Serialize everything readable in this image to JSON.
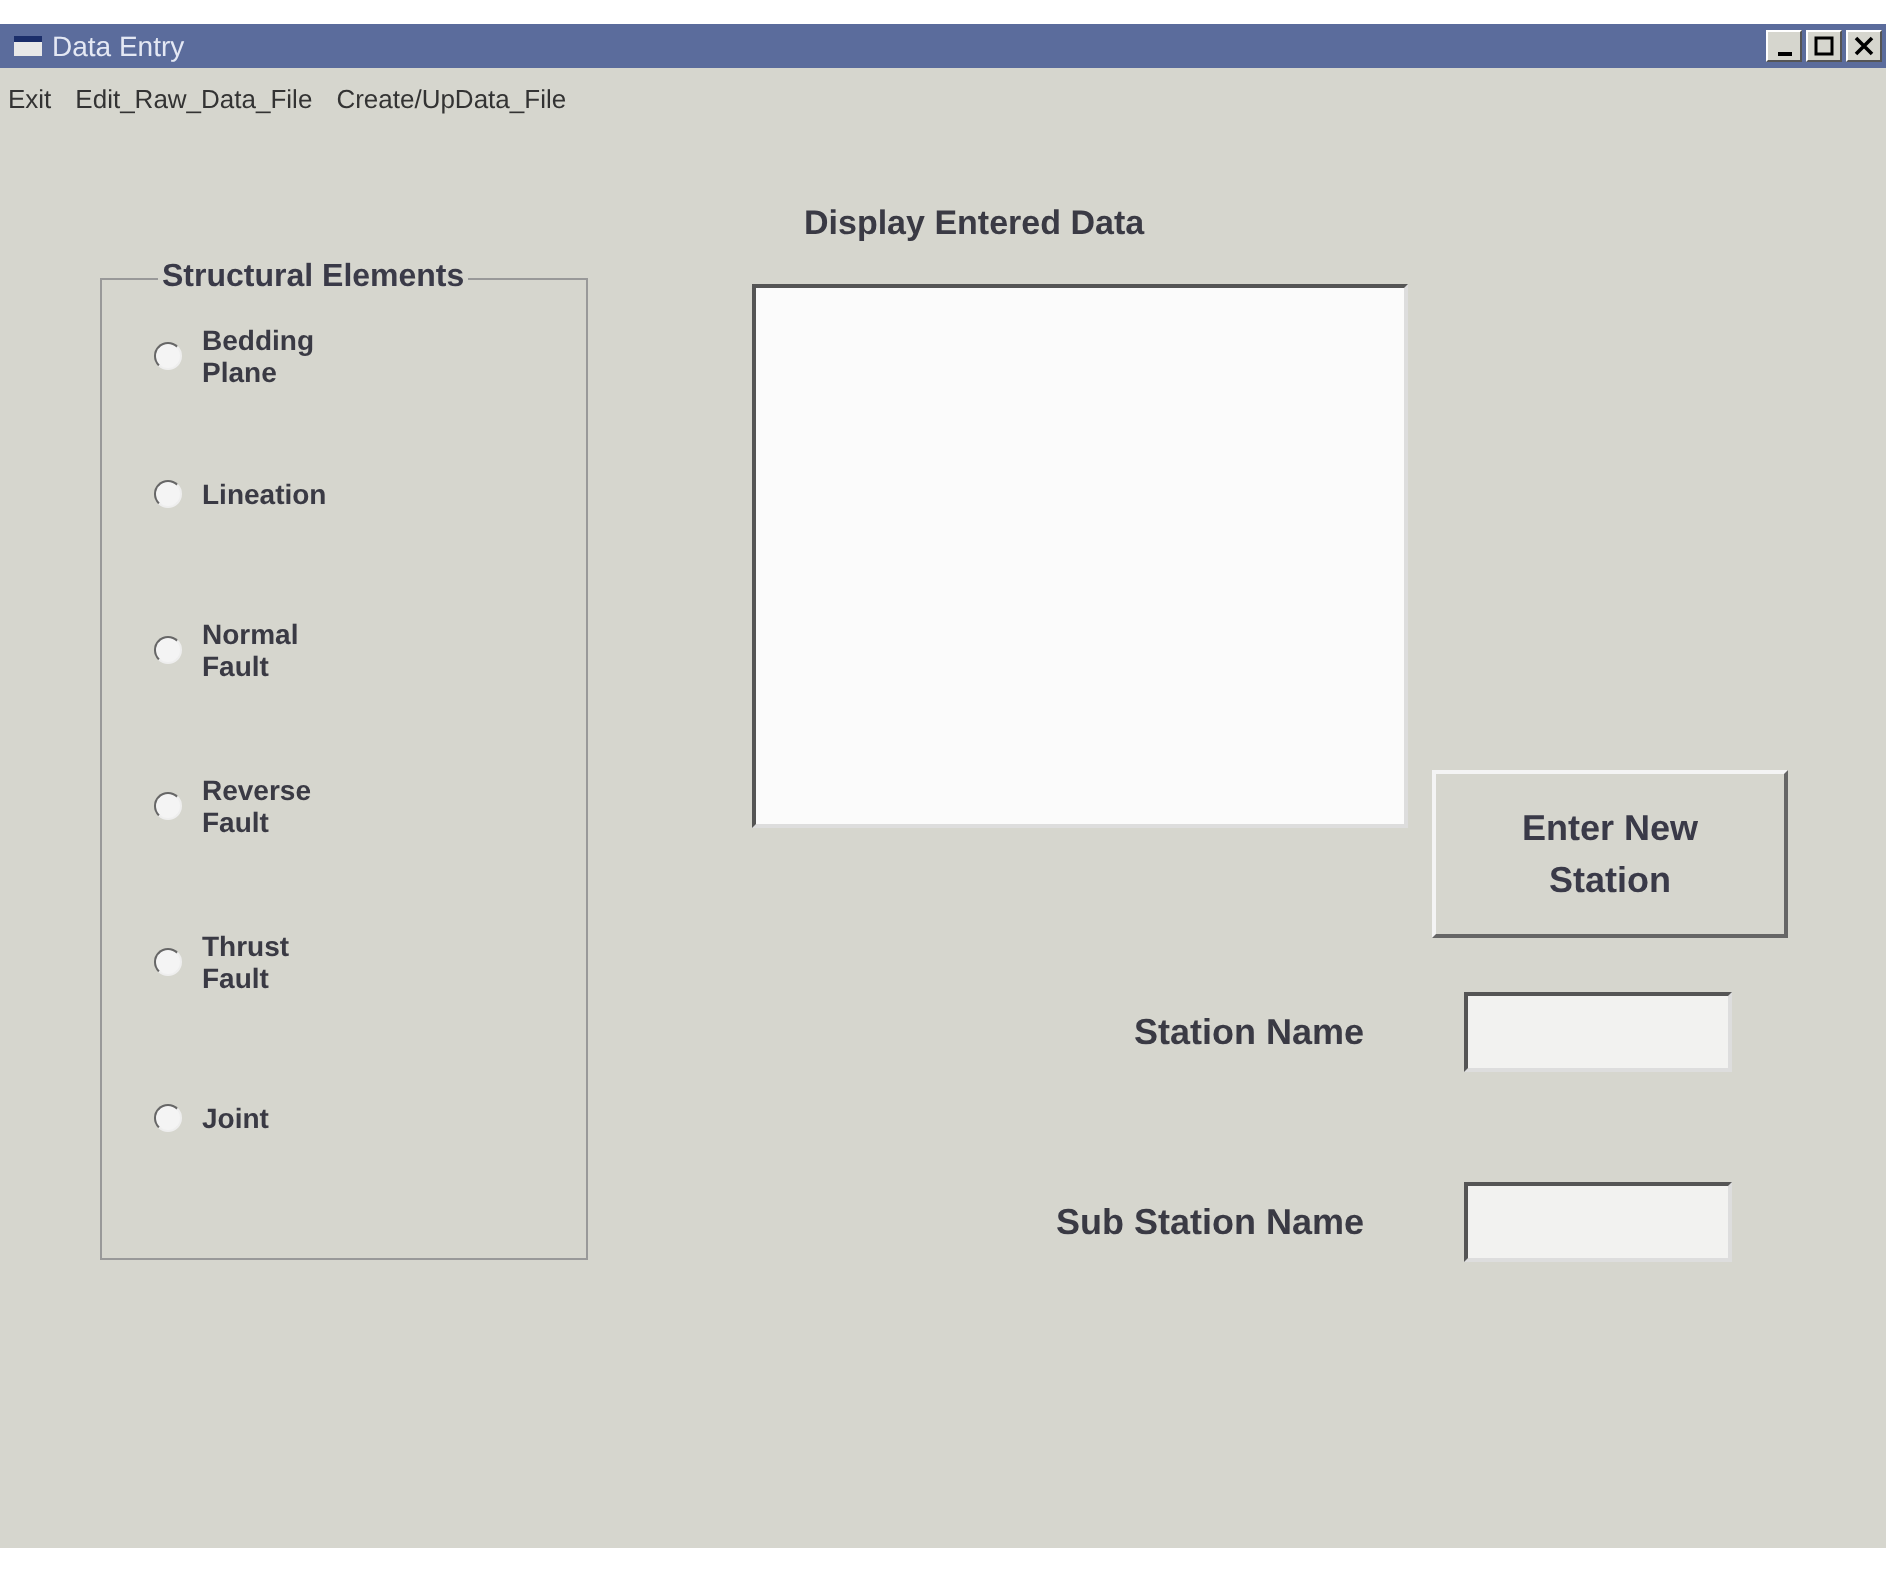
{
  "window": {
    "title": "Data Entry"
  },
  "menu": [
    "Exit",
    "Edit_Raw_Data_File",
    "Create/UpData_File"
  ],
  "structural_elements": {
    "title": "Structural Elements",
    "options": [
      {
        "label": "Bedding Plane",
        "selected": false
      },
      {
        "label": "Lineation",
        "selected": false
      },
      {
        "label": "Normal Fault",
        "selected": false
      },
      {
        "label": "Reverse Fault",
        "selected": false
      },
      {
        "label": "Thrust Fault",
        "selected": false
      },
      {
        "label": "Joint",
        "selected": false
      }
    ]
  },
  "display": {
    "title": "Display Entered Data"
  },
  "enter_button": "Enter New Station",
  "fields": [
    {
      "label": "Station Name"
    },
    {
      "label": "Sub Station Name"
    }
  ]
}
